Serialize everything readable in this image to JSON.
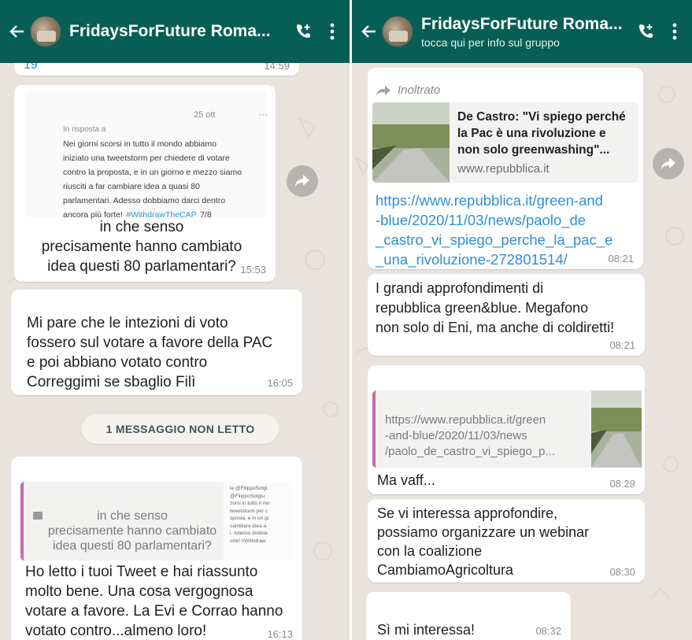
{
  "left": {
    "header": {
      "title": "FridaysForFuture Roma..."
    },
    "top_partial": {
      "time": "14:59",
      "fragment": "19"
    },
    "tweet_reply": {
      "date": "25 ott",
      "more": "···",
      "in_reply": "In risposta a",
      "body": "Nei giorni scorsi in tutto il mondo abbiamo\niniziato una tweetstorm per chiedere di votare\ncontro la proposta, e in un giorno e mezzo siamo\nriusciti a far cambiare idea a quasi 80\nparlamentari. Adesso dobbiamo darci dentro\nancora più forte!",
      "hashtag": "#WithdrawTheCAP",
      "count": "7/8",
      "message": "in che senso\nprecisamente hanno cambiato\nidea questi 80 parlamentari?",
      "time": "15:53"
    },
    "msg_pac": {
      "text": "Mi pare che le intezioni di voto\nfossero sul votare a favore della PAC\ne poi abbiano votato contro\nCorreggimi se sbaglio Filì",
      "time": "16:05"
    },
    "unread_label": "1 MESSAGGIO NON LETTO",
    "reply_msg": {
      "quote_text": "in che senso\nprecisamente hanno cambiato\nidea questi 80 parlamentari?",
      "quote_side": "le @FilippoSotgi\n@FilippoSotgiu\nzorsi in tutto il mo\ntweetstorm per c\nsposta, e in un gi\ncambiare idea a\ni. Adesso dobbia\norte! #Withdraw",
      "text": "Ho letto i tuoi Tweet e hai riassunto\nmolto bene. Una cosa vergognosa\nvotare a favore. La Evi e Corrao hanno\nvotato contro...almeno loro!",
      "time": "16:13"
    }
  },
  "right": {
    "header": {
      "title": "FridaysForFuture Roma...",
      "subtitle": "tocca qui per info sul gruppo"
    },
    "forwarded": {
      "label": "Inoltrato",
      "preview_title": "De Castro: \"Vi spiego perché\nla Pac è una rivoluzione e\nnon solo greenwashing\"...",
      "preview_site": "www.repubblica.it",
      "url": "https://www.repubblica.it/green-and\n-blue/2020/11/03/news/paolo_de\n_castro_vi_spiego_perche_la_pac_e\n_una_rivoluzione-272801514/",
      "time": "08:21"
    },
    "msg_megafono": {
      "text": "I grandi approfondimenti di\nrepubblica green&blue. Megafono\nnon solo di Eni, ma anche di coldiretti!",
      "time": "08:21"
    },
    "msg_vaff": {
      "quote_url": "https://www.repubblica.it/green\n-and-blue/2020/11/03/news\n/paolo_de_castro_vi_spiego_p...",
      "text": "Ma vaff...",
      "time": "08:29"
    },
    "msg_webinar": {
      "text": "Se vi interessa approfondire,\npossiamo organizzare un webinar\ncon la coalizione\nCambiamoAgricoltura",
      "time": "08:30"
    },
    "msg_si": {
      "text": "Sì mi interessa!",
      "time": "08:32"
    }
  },
  "colors": {
    "header": "#075e54",
    "link": "#2f8fd6",
    "wallpaper": "#e8e3dc",
    "quote_bar": "#c86aa4"
  }
}
